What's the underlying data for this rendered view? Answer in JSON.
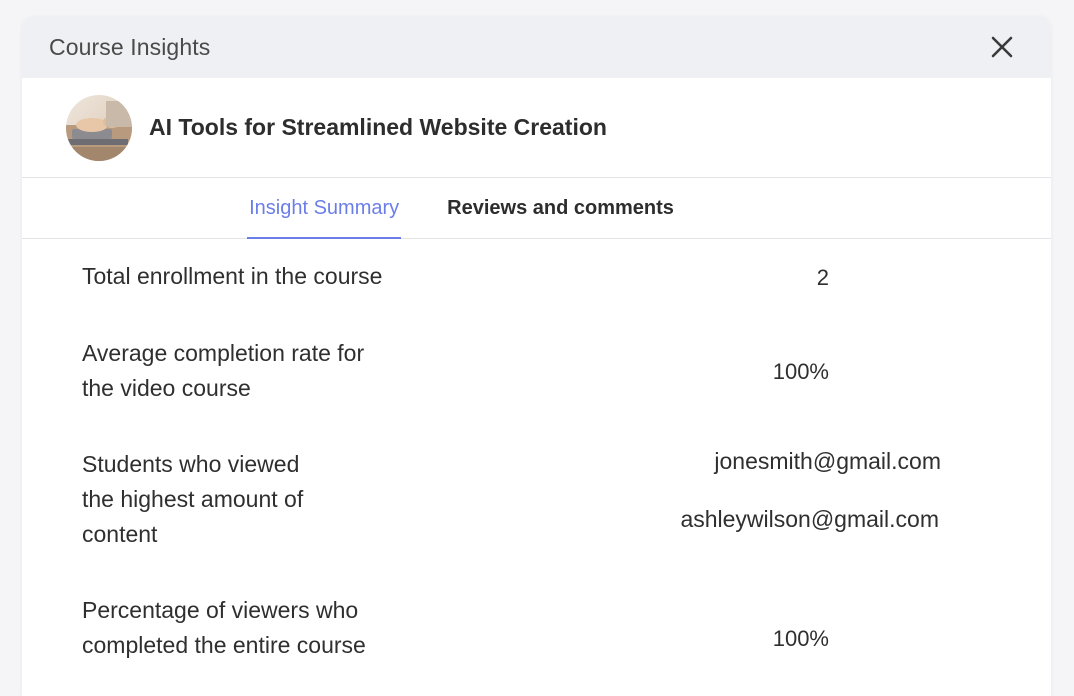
{
  "modal": {
    "title": "Course Insights"
  },
  "course": {
    "title": "AI Tools for Streamlined Website Creation",
    "thumbnail_icon": "course-thumbnail-image"
  },
  "tabs": [
    {
      "label": "Insight Summary",
      "active": true
    },
    {
      "label": "Reviews and comments",
      "active": false
    }
  ],
  "insights": [
    {
      "label_lines": [
        "Total enrollment in the course"
      ],
      "value": "2"
    },
    {
      "label_lines": [
        "Average completion rate for",
        "the video course"
      ],
      "value": "100%"
    },
    {
      "label_lines": [
        "Students who viewed",
        "the highest amount of",
        "content"
      ],
      "values": [
        "jonesmith@gmail.com",
        "ashleywilson@gmail.com"
      ]
    },
    {
      "label_lines": [
        "Percentage of viewers who",
        "completed the entire course"
      ],
      "value": "100%"
    }
  ],
  "colors": {
    "accent": "#6b7ee8",
    "header_bg": "#eff0f3"
  }
}
